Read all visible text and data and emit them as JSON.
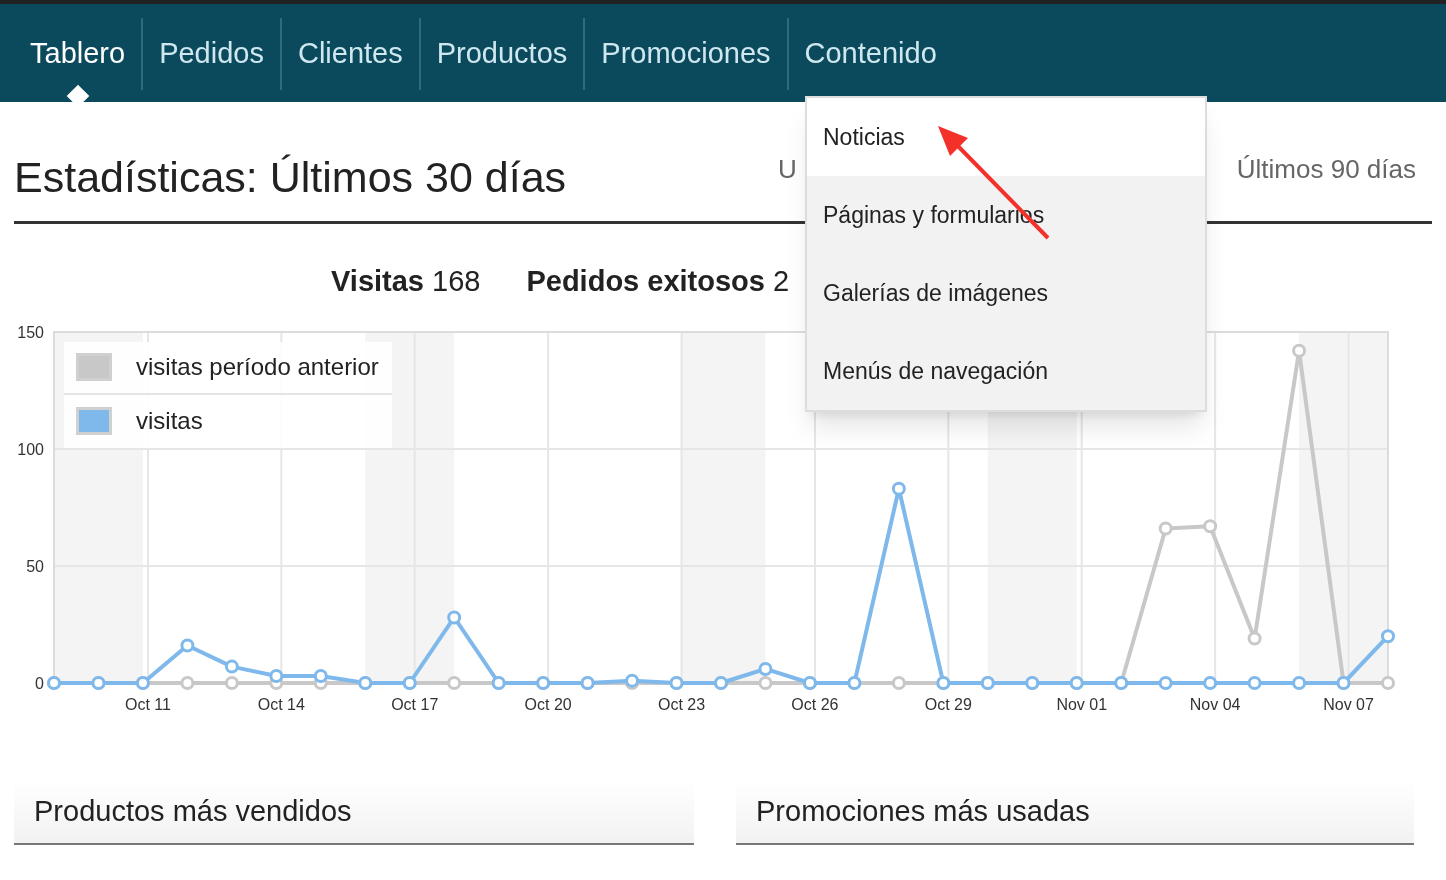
{
  "nav": {
    "tabs": [
      {
        "label": "Tablero",
        "selected": true
      },
      {
        "label": "Pedidos",
        "selected": false
      },
      {
        "label": "Clientes",
        "selected": false
      },
      {
        "label": "Productos",
        "selected": false
      },
      {
        "label": "Promociones",
        "selected": false
      },
      {
        "label": "Contenido",
        "selected": false
      }
    ]
  },
  "dropdown": {
    "items": [
      {
        "label": "Noticias",
        "highlighted": true
      },
      {
        "label": "Páginas y formularios",
        "highlighted": false
      },
      {
        "label": "Galerías de imágenes",
        "highlighted": false
      },
      {
        "label": "Menús de navegación",
        "highlighted": false
      }
    ]
  },
  "heading": "Estadísticas: Últimos 30 días",
  "ranges": [
    "U",
    "Últimos 90 días"
  ],
  "stats": [
    "**Visitas** 168",
    "**Pedidos exitosos** 2"
  ],
  "chart": {
    "chart_data": {
      "type": "line",
      "categories": [
        null,
        null,
        "Oct 11",
        null,
        null,
        "Oct 14",
        null,
        null,
        "Oct 17",
        null,
        null,
        "Oct 20",
        null,
        null,
        "Oct 23",
        null,
        null,
        "Oct 26",
        null,
        null,
        "Oct 29",
        null,
        null,
        "Nov 01",
        null,
        null,
        "Nov 04",
        null,
        null,
        "Nov 07",
        null
      ],
      "grid": true,
      "legend": true,
      "series": [
        {
          "name": "visitas período anterior",
          "color": "#c8c8c8",
          "marker": "o",
          "values": [
            0,
            0,
            0,
            0,
            0,
            0,
            0,
            0,
            0,
            0,
            0,
            0,
            0,
            0,
            0,
            0,
            0,
            0,
            0,
            0,
            0,
            0,
            0,
            0,
            0,
            66,
            67,
            19,
            142,
            0,
            0
          ]
        },
        {
          "name": "visitas",
          "color": "#7fb8ea",
          "marker": "o",
          "values": [
            0,
            0,
            0,
            16,
            7,
            3,
            3,
            0,
            0,
            28,
            0,
            0,
            0,
            1,
            0,
            0,
            6,
            0,
            0,
            83,
            0,
            0,
            0,
            0,
            0,
            0,
            0,
            0,
            0,
            0,
            20
          ]
        }
      ],
      "ylim": [
        0,
        150
      ],
      "yticks": [
        0,
        50,
        100,
        150
      ]
    }
  },
  "sections": [
    "Productos más vendidos",
    "Promociones más usadas"
  ]
}
